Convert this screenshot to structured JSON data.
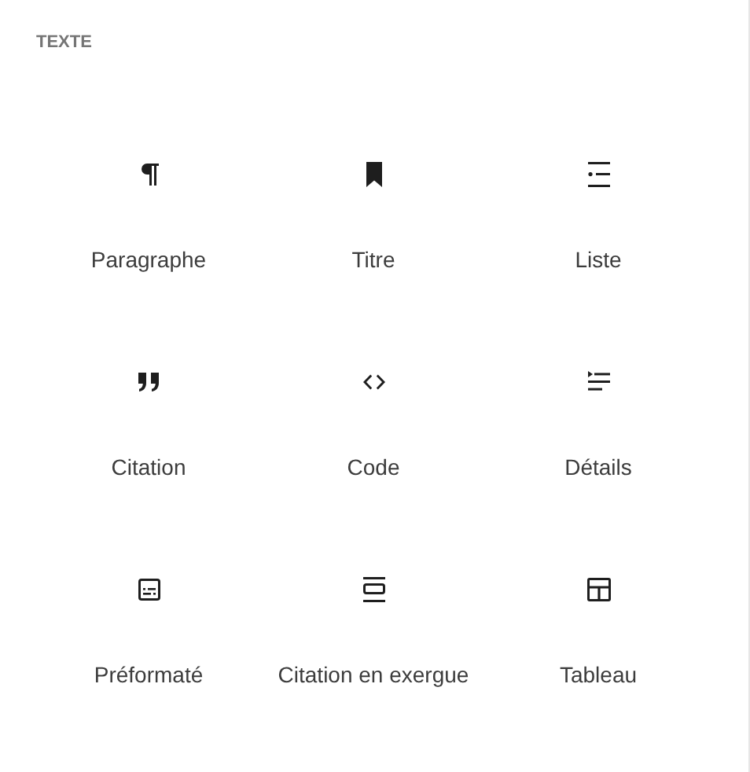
{
  "section": {
    "title": "TEXTE"
  },
  "blocks": [
    {
      "kind": "paragraph",
      "label": "Paragraphe"
    },
    {
      "kind": "heading",
      "label": "Titre"
    },
    {
      "kind": "list",
      "label": "Liste"
    },
    {
      "kind": "quote",
      "label": "Citation"
    },
    {
      "kind": "code",
      "label": "Code"
    },
    {
      "kind": "details",
      "label": "Détails"
    },
    {
      "kind": "preformatted",
      "label": "Préformaté"
    },
    {
      "kind": "pullquote",
      "label": "Citation en exergue"
    },
    {
      "kind": "table",
      "label": "Tableau"
    }
  ]
}
